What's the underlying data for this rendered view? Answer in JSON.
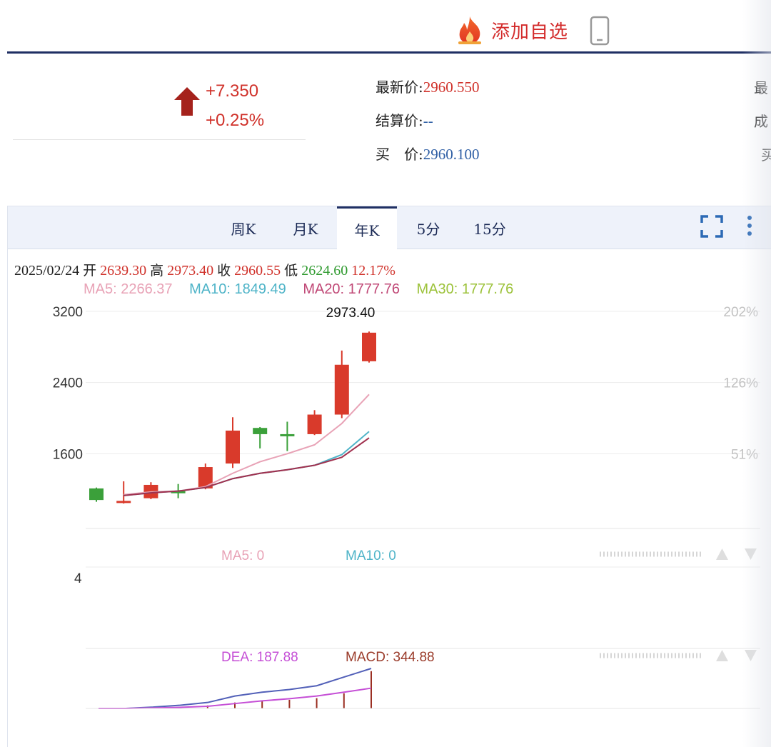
{
  "header": {
    "add_watchlist_label": "添加自选",
    "accent_color": "#d32b2b"
  },
  "change": {
    "abs": "+7.350",
    "pct": "+0.25%",
    "direction": "up"
  },
  "quote": {
    "latest_label": "最新价:",
    "latest_value": "2960.550",
    "settle_label": "结算价:",
    "settle_value": "--",
    "bid_label": "买　价:",
    "bid_value": "2960.100",
    "edge_chars": [
      "最",
      "成",
      "买"
    ]
  },
  "tabs": [
    {
      "label": "周K",
      "active": false
    },
    {
      "label": "月K",
      "active": false
    },
    {
      "label": "年K",
      "active": true
    },
    {
      "label": "5分",
      "active": false
    },
    {
      "label": "15分",
      "active": false
    }
  ],
  "ohlc": {
    "date": "2025/02/24",
    "open_label": "开",
    "open": "2639.30",
    "high_label": "高",
    "high": "2973.40",
    "close_label": "收",
    "close": "2960.55",
    "low_label": "低",
    "low": "2624.60",
    "pct": "12.17%"
  },
  "ma": [
    {
      "text": "MA5: 2266.37",
      "color": "#e8a2b6"
    },
    {
      "text": "MA10: 1849.49",
      "color": "#4fb4c8"
    },
    {
      "text": "MA20: 1777.76",
      "color": "#c04876"
    },
    {
      "text": "MA30: 1777.76",
      "color": "#9cc23a"
    }
  ],
  "chart_data": {
    "type": "candlestick",
    "y_ticks": [
      "3200",
      "2400",
      "1600"
    ],
    "pct_ticks": [
      "202%",
      "126%",
      "51%"
    ],
    "high_label": "2973.40",
    "ylim": [
      760,
      3300
    ],
    "candles": [
      {
        "open": 1210,
        "close": 1080,
        "high": 1220,
        "low": 1060,
        "dir": "down"
      },
      {
        "open": 1060,
        "close": 1070,
        "high": 1290,
        "low": 1040,
        "dir": "up"
      },
      {
        "open": 1100,
        "close": 1250,
        "high": 1280,
        "low": 1090,
        "dir": "up"
      },
      {
        "open": 1180,
        "close": 1160,
        "high": 1260,
        "low": 1100,
        "dir": "down"
      },
      {
        "open": 1210,
        "close": 1450,
        "high": 1490,
        "low": 1200,
        "dir": "up"
      },
      {
        "open": 1490,
        "close": 1860,
        "high": 2010,
        "low": 1440,
        "dir": "up"
      },
      {
        "open": 1890,
        "close": 1820,
        "high": 1900,
        "low": 1660,
        "dir": "down"
      },
      {
        "open": 1820,
        "close": 1810,
        "high": 1960,
        "low": 1630,
        "dir": "down"
      },
      {
        "open": 1820,
        "close": 2040,
        "high": 2090,
        "low": 1810,
        "dir": "up"
      },
      {
        "open": 2040,
        "close": 2600,
        "high": 2760,
        "low": 2000,
        "dir": "up"
      },
      {
        "open": 2639.3,
        "close": 2960.55,
        "high": 2973.4,
        "low": 2624.6,
        "dir": "up"
      }
    ],
    "ma5": [
      null,
      1140,
      1170,
      1180,
      1230,
      1380,
      1510,
      1600,
      1700,
      1940,
      2266.37
    ],
    "ma10": [
      null,
      1130,
      1160,
      1180,
      1220,
      1320,
      1380,
      1420,
      1470,
      1590,
      1849.49
    ],
    "ma20": [
      null,
      1130,
      1160,
      1180,
      1220,
      1320,
      1380,
      1420,
      1470,
      1560,
      1777.76
    ],
    "volume_indicators": [
      {
        "text": "MA5: 0",
        "color": "#e8a2b6"
      },
      {
        "text": "MA10: 0",
        "color": "#4fb4c8"
      }
    ],
    "volume_tick": "4",
    "macd_indicators": [
      {
        "text": "DEA: 187.88",
        "color": "#c54fd6"
      },
      {
        "text": "MACD: 344.88",
        "color": "#9a3b2a"
      }
    ],
    "dif": [
      0,
      0,
      12,
      30,
      55,
      115,
      150,
      175,
      210,
      290,
      370
    ],
    "dea": [
      0,
      0,
      4,
      10,
      20,
      45,
      70,
      90,
      115,
      150,
      187.88
    ],
    "macd_bars": [
      0,
      0,
      6,
      14,
      28,
      55,
      72,
      80,
      95,
      140,
      344.88
    ]
  }
}
